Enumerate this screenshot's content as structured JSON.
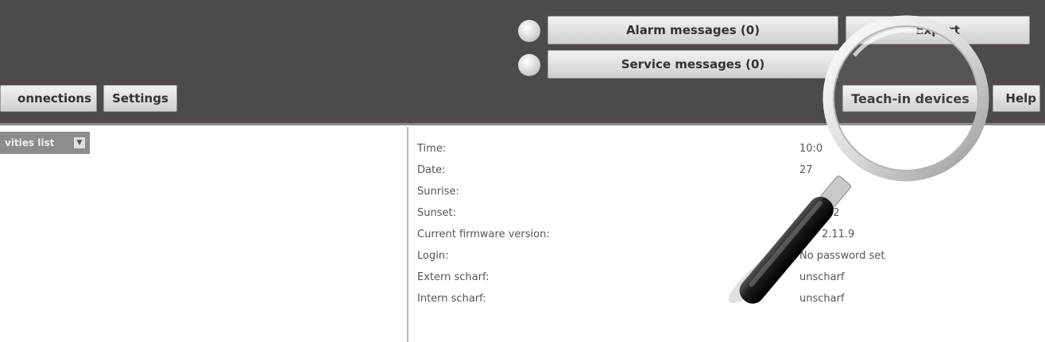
{
  "header": {
    "alarm_messages": "Alarm messages (0)",
    "service_messages": "Service messages (0)",
    "export_label": "Export",
    "connections_label": "onnections",
    "settings_label": "Settings",
    "teach_in_label": "Teach-in devices",
    "help_label": "Help"
  },
  "sidebar": {
    "dropdown_label": "vities list"
  },
  "info": {
    "rows": [
      {
        "label": "Time:",
        "value": "10:0"
      },
      {
        "label": "Date:",
        "value": "27"
      },
      {
        "label": "Sunrise:",
        "value": ""
      },
      {
        "label": "Sunset:",
        "value": "42"
      },
      {
        "label": "Current firmware version:",
        "value": "2.11.9"
      },
      {
        "label": "Login:",
        "value": "No password set"
      },
      {
        "label": "Extern scharf:",
        "value": "unscharf"
      },
      {
        "label": "Intern scharf:",
        "value": "unscharf"
      }
    ]
  },
  "icons": {
    "dropdown_arrow": "chevron-down-icon",
    "magnifier": "magnifying-glass-icon",
    "led": "status-led-icon"
  }
}
